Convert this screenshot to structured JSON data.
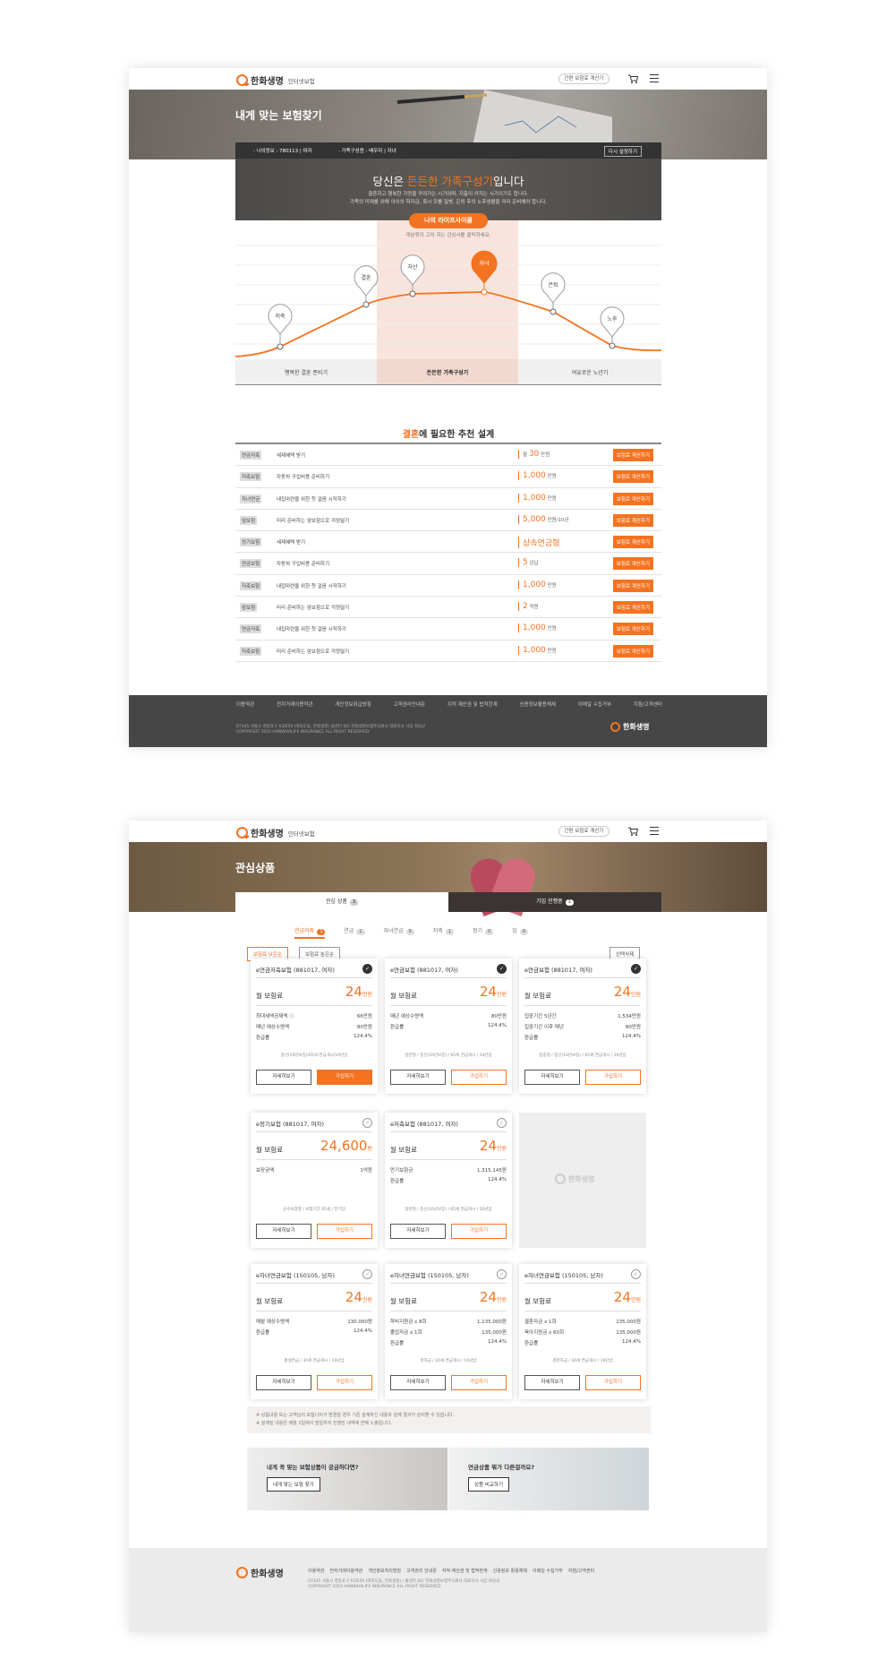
{
  "brand": {
    "name": "한화생명",
    "sub": "인터넷보험",
    "header_btn": "간편 보험료 계산기",
    "accent": "#f37321"
  },
  "page1": {
    "hero_title": "내게 맞는 보험찾기",
    "info": {
      "my": "· 나의정보 : 780113 | 여자",
      "family": "· 가족구성원 : 배우자 | 자녀",
      "reset": "다시 설정하기"
    },
    "headline_pre": "당신은 ",
    "headline_em": "든든한 가족구성기",
    "headline_post": "입니다",
    "desc1": "결혼하고 행복한 가정을 꾸려가는 시기이며, 지출이 커지는 시기이기도 합니다.",
    "desc2": "가족의 미래를 위해 아이의 학자금, 혹시 모를 질병, 은퇴 후의 노후생활을 미리 준비해야 합니다.",
    "lifecycle_btn": "나의 라이프사이클",
    "lifecycle_hint": "대분류의 고치 하는 관심사를 클릭하세요.",
    "stages": [
      "저축",
      "결혼",
      "자산",
      "자녀",
      "은퇴",
      "노후"
    ],
    "periods": [
      "행복한 결혼 준비기",
      "든든한 가족구성기",
      "여유로운 노년기"
    ],
    "rec_title_em": "결혼",
    "rec_title": "에 필요한 추천 설계",
    "rows": [
      {
        "tag": "연금저축",
        "desc": "세제혜택 받기",
        "pre": "월",
        "amt": "30",
        "unit": "만원"
      },
      {
        "tag": "저축보험",
        "desc": "자동차 구입비용 준비하기",
        "pre": "",
        "amt": "1,000",
        "unit": "만원"
      },
      {
        "tag": "자녀연금",
        "desc": "내집마련을 위한 첫 걸음 시작하기",
        "pre": "",
        "amt": "1,000",
        "unit": "만원"
      },
      {
        "tag": "암보험",
        "desc": "미리 준비하는 암보험으로 걱정덜기",
        "pre": "",
        "amt": "5,000",
        "unit": "만원/10년"
      },
      {
        "tag": "정기보험",
        "desc": "세제혜택 받기",
        "pre": "",
        "amt": "상속연금형",
        "unit": ""
      },
      {
        "tag": "연금보험",
        "desc": "자동차 구입비용 준비하기",
        "pre": "",
        "amt": "5",
        "unit": "년납"
      },
      {
        "tag": "저축보험",
        "desc": "내집마련을 위한 첫 걸음 시작하기",
        "pre": "",
        "amt": "1,000",
        "unit": "만원"
      },
      {
        "tag": "암보험",
        "desc": "미리 준비하는 암보험으로 걱정덜기",
        "pre": "",
        "amt": "2",
        "unit": "억원"
      },
      {
        "tag": "연금저축",
        "desc": "내집마련을 위한 첫 걸음 시작하기",
        "pre": "",
        "amt": "1,000",
        "unit": "만원"
      },
      {
        "tag": "저축보험",
        "desc": "미리 준비하는 암보험으로 걱정덜기",
        "pre": "",
        "amt": "1,000",
        "unit": "만원"
      }
    ],
    "row_btn": "보험료 계산하기",
    "footer_links": [
      "이용약관",
      "전자거래이용약관",
      "개인정보취급방침",
      "고객권리안내문",
      "지적 재산권 및 법적한계",
      "신용정보활용체제",
      "이메일 수집거부",
      "지점/고객센터"
    ],
    "footer_addr": "07345 서울시 영등포구 63로50 (여의도동, 한화생명) 콜센터 82) 한화생명보험주식회사 대표이사 사장 차남규",
    "footer_copy": "COPYRIGHT 2016 HANWHALIFE INSURANCE ALL RIGHT RESERVED"
  },
  "page2": {
    "hero_title": "관심상품",
    "tab_interest": "관심 상품",
    "tab_interest_count": "3",
    "tab_join": "가입 진행중",
    "tab_join_count": "3",
    "subtabs": [
      {
        "label": "연금저축",
        "count": "3"
      },
      {
        "label": "연금",
        "count": "1"
      },
      {
        "label": "자녀연금",
        "count": "0"
      },
      {
        "label": "저축",
        "count": "1"
      },
      {
        "label": "정기",
        "count": "0"
      },
      {
        "label": "암",
        "count": "0"
      }
    ],
    "sort_low": "보험료 낮은순",
    "sort_high": "보험료 높은순",
    "delete_selected": "선택삭제",
    "premium_label": "월 보험료",
    "btn_detail": "자세히보기",
    "btn_join": "가입하기",
    "cards": [
      {
        "title": "e연금저축보험 (881017, 여자)",
        "amt": "24",
        "unit": "만원",
        "checked": true,
        "kv": [
          [
            "최대세액공제액 ⓘ",
            "66만원"
          ],
          [
            "매년 예상수령액",
            "80만원"
          ],
          [
            "환급률",
            "124.4%"
          ]
        ],
        "note": "종신(10년보증)/65세 연금개시/10년납",
        "join_fill": true
      },
      {
        "title": "e연금보험 (881017, 여자)",
        "amt": "24",
        "unit": "만원",
        "checked": true,
        "kv": [
          [
            "매년 예상수령액",
            "80만원"
          ],
          [
            "환급률",
            "124.4%"
          ]
        ],
        "note": "일반형 / 종신(10년보증) / 65세 연금개시 / 10년납",
        "join_fill": false
      },
      {
        "title": "e연금보험 (881017, 여자)",
        "amt": "24",
        "unit": "만원",
        "checked": true,
        "kv": [
          [
            "집중기간 5년간",
            "1,534만원"
          ],
          [
            "집중기간 이후 매년",
            "80만원"
          ],
          [
            "환급률",
            "124.4%"
          ]
        ],
        "note": "집중형 / 종신(10년보증) / 65세 연금개시 / 10년납",
        "join_fill": false
      },
      {
        "title": "e정기보험 (881017, 여자)",
        "amt": "24,600",
        "unit": "원",
        "checked": false,
        "kv": [
          [
            "보장금액",
            "1억원"
          ]
        ],
        "note": "순수보장형 / 보험기간 65세 / 전기납",
        "join_fill": false
      },
      {
        "title": "e저축보험 (881017, 여자)",
        "amt": "24",
        "unit": "만원",
        "checked": false,
        "kv": [
          [
            "만기보험금",
            "1,315,145원"
          ],
          [
            "환급률",
            "124.4%"
          ]
        ],
        "note": "일반형 / 종신(10년보증) / 65세 연금개시 / 10년납",
        "join_fill": false
      },
      {
        "title": "e자녀연금보험 (150105, 남자)",
        "amt": "24",
        "unit": "만원",
        "checked": false,
        "kv": [
          [
            "매월 예상수령액",
            "130,000원"
          ],
          [
            "환급률",
            "124.4%"
          ]
        ],
        "note": "평생연금 / 30세 연금개시 / 10년납",
        "join_fill": false
      },
      {
        "title": "e자녀연금보험 (150105, 남자)",
        "amt": "24",
        "unit": "만원",
        "checked": false,
        "kv": [
          [
            "학비지원금 x 8회",
            "1,135,000원"
          ],
          [
            "졸업자금 x 1회",
            "135,000원"
          ],
          [
            "환급률",
            "124.4%"
          ]
        ],
        "note": "학자금 / 20세 연금개시 / 10년납",
        "join_fill": false
      },
      {
        "title": "e자녀연금보험 (150105, 남자)",
        "amt": "24",
        "unit": "만원",
        "checked": false,
        "kv": [
          [
            "결혼자금 x 1회",
            "135,000원"
          ],
          [
            "육아지원금 x 60회",
            "135,000원"
          ],
          [
            "환급률",
            "124.4%"
          ]
        ],
        "note": "결혼자금 / 30세 연금개시 / 10년납",
        "join_fill": false
      }
    ],
    "empty_logo": "한화생명",
    "notice1": "※ 상품내용 또는 고객님의 보험나이가 변경될 경우 기존 설계하신 내용과 설계 결과가 상이할 수 있습니다.",
    "notice2": "※ 설계된 내용은 매월 1일에서 말일까지 진행한 내역에 한해 노출됩니다.",
    "banner1_q": "내게 꼭 맞는 보험상품이 궁금하다면?",
    "banner1_btn": "내게 맞는 보험 찾기",
    "banner2_q": "연금상품 뭐가 다른걸까요?",
    "banner2_btn": "상품 비교하기",
    "footer_links": [
      "이용약관",
      "전자거래이용약관",
      "개인정보처리방침",
      "고객권리 안내문",
      "지적 재산권 및 법적한계",
      "신용정보 활용체제",
      "이메일 수집거부",
      "지점/고객센터"
    ],
    "footer_addr": "07345 서울시 영등포구 63로50 (여의도동, 한화생명) / 콜센터 82) 한화생명보험주식회사 대표이사 사장 차남규",
    "footer_copy": "COPYRIGHT 2016 HANWHALIFE INSURANCE ALL RIGHT RESERVED"
  }
}
